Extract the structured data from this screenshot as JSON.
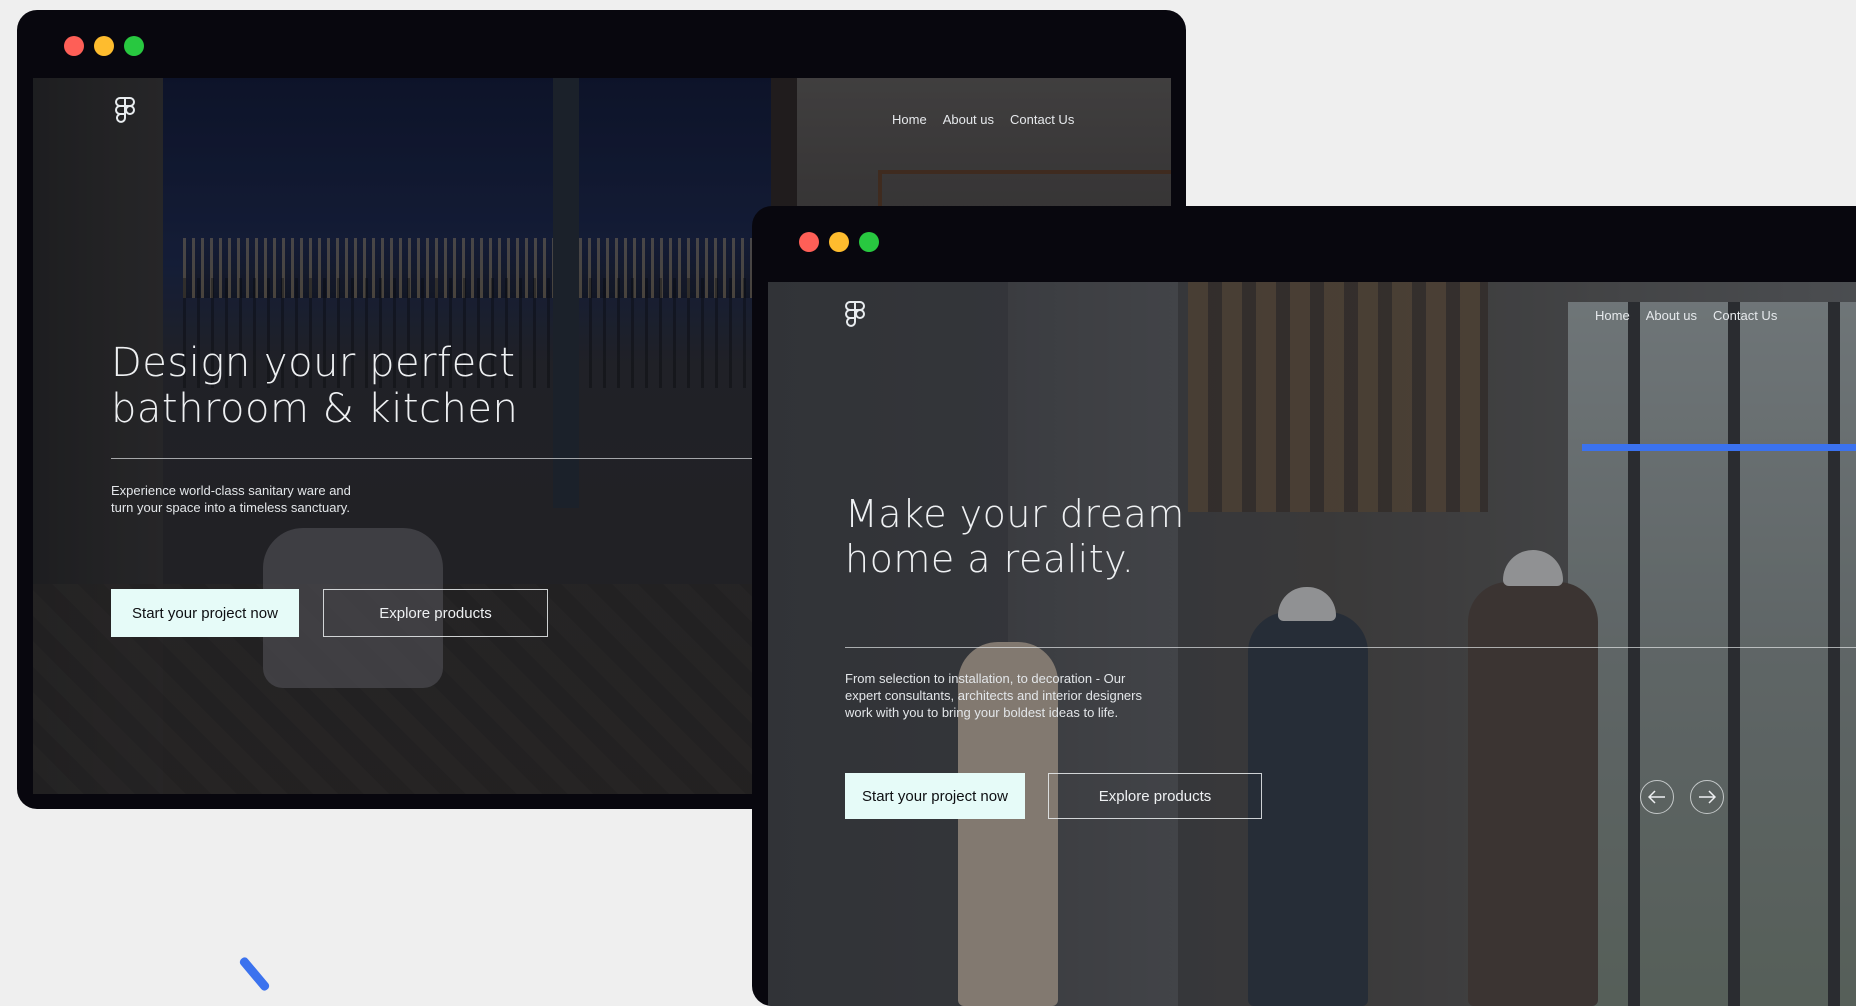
{
  "colors": {
    "accent": "#3b72ee",
    "window": "#08070e",
    "button_bg": "#e6fbf8"
  },
  "window1": {
    "nav": [
      "Home",
      "About us",
      "Contact Us"
    ],
    "heading_line1": "Design your perfect",
    "heading_line2": "bathroom & kitchen",
    "subtitle_line1": "Experience world-class sanitary ware and",
    "subtitle_line2": "turn your space into a timeless sanctuary.",
    "primary_button": "Start your project now",
    "secondary_button": "Explore products"
  },
  "window2": {
    "nav": [
      "Home",
      "About us",
      "Contact Us"
    ],
    "heading_line1": "Make your dream",
    "heading_line2": "home a reality.",
    "subtitle_line1": "From selection to installation, to decoration - Our",
    "subtitle_line2": "expert consultants, architects and interior designers",
    "subtitle_line3": "work with you to bring your boldest ideas to life.",
    "primary_button": "Start your project now",
    "secondary_button": "Explore products",
    "icons": {
      "prev": "arrow-left-icon",
      "next": "arrow-right-icon",
      "logo": "figma-logo-icon"
    }
  }
}
